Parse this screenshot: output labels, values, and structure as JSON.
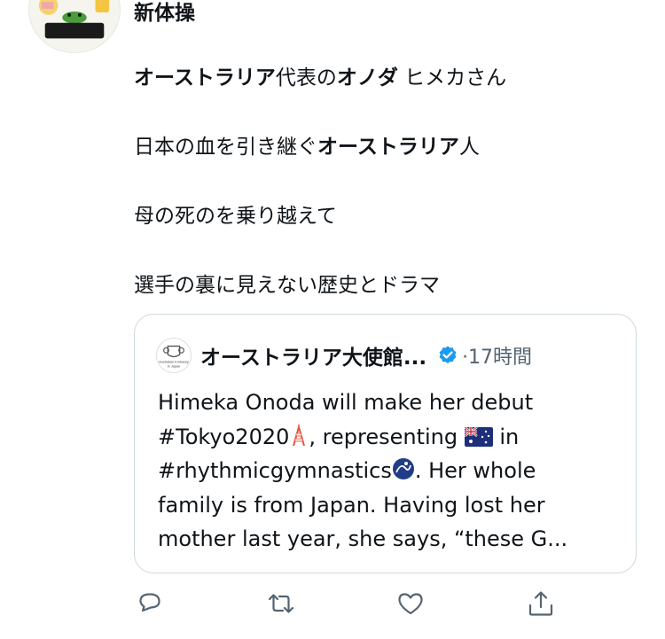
{
  "author": {
    "display_name": "新体操"
  },
  "body": {
    "line1": [
      "オーストラリア",
      "代表の",
      "オノダ",
      " ヒメカさん"
    ],
    "line2": [
      "日本の血を引き継ぐ",
      "オーストラリア",
      "人"
    ],
    "line3": "母の死のを乗り越えて",
    "line4": "選手の裏に見えない歴史とドラマ"
  },
  "quote": {
    "name": "オーストラリア大使館...",
    "meta": "·17時間",
    "avatar_text": [
      "Australian Embassy",
      "in Japan"
    ],
    "text": {
      "line1": "Himeka Onoda will make her debut",
      "line2_a": "#Tokyo2020",
      "line2_b": ", representing",
      "line2_c": " in",
      "line3_a": "#rhythmicgymnastics",
      "line3_b": ". Her whole",
      "line4": "family is from Japan. Having lost her",
      "line5": "mother last year, she says, “these G..."
    }
  },
  "icons": {
    "tower": "tokyo-tower-icon",
    "flag": "australia-flag-icon",
    "sport": "gymnastics-ribbon-icon",
    "reply": "reply-icon",
    "retweet": "retweet-icon",
    "like": "like-icon",
    "share": "share-icon",
    "verified": "verified-badge-icon"
  },
  "colors": {
    "text": "#0f1419",
    "muted": "#536471",
    "border": "#cfd9de",
    "verified": "#1d9bf0"
  }
}
